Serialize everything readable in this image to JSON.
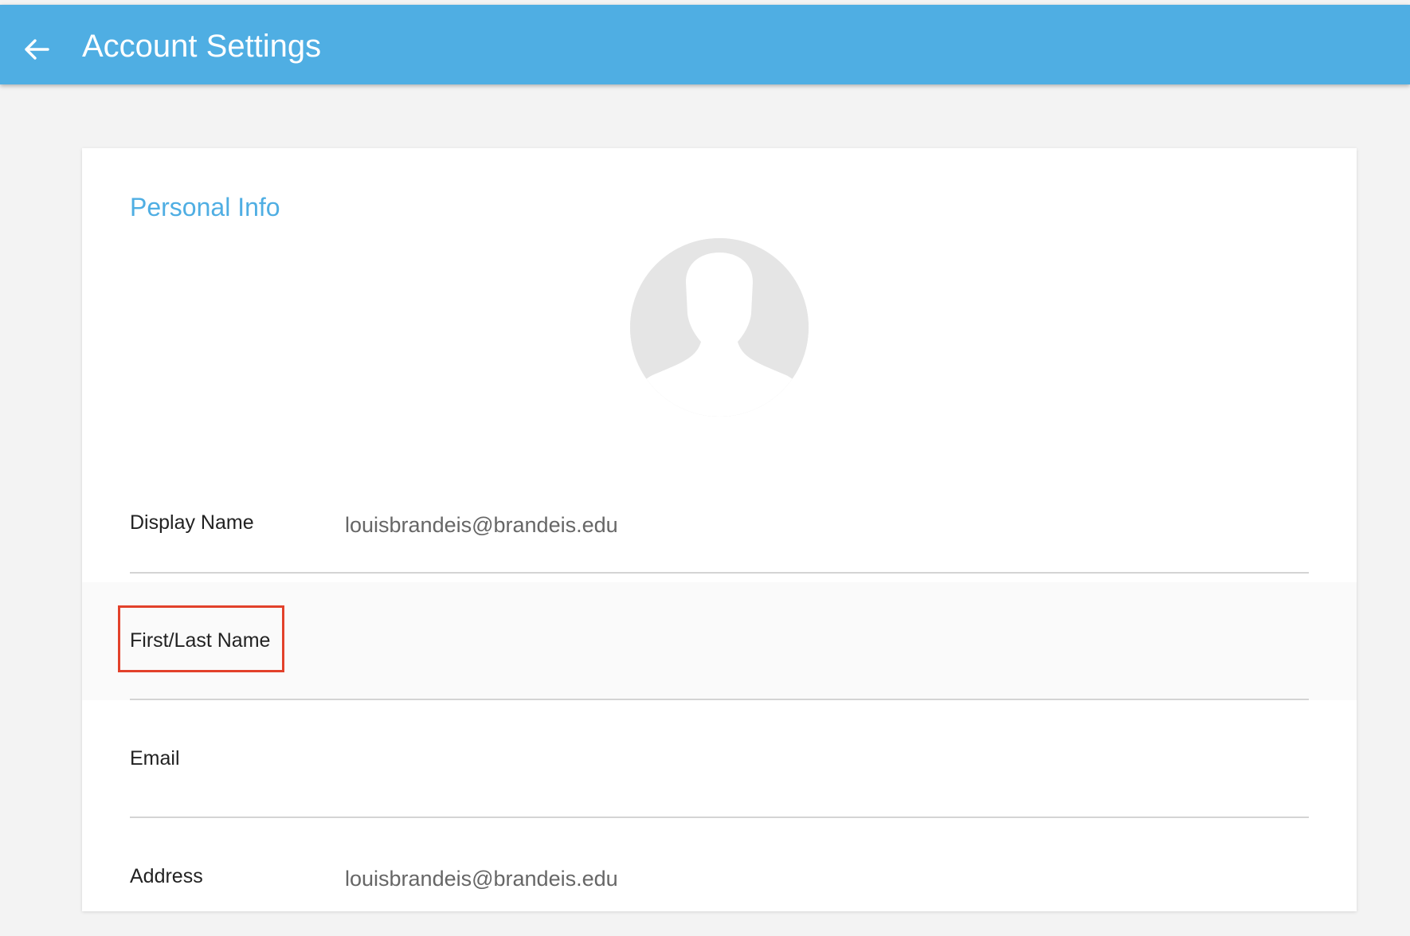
{
  "header": {
    "title": "Account Settings",
    "back_icon": "arrow-left-icon",
    "background_color": "#4faee3"
  },
  "card": {
    "section_title": "Personal Info",
    "avatar_icon": "user-silhouette-icon",
    "fields": [
      {
        "label": "Display Name",
        "value": "louisbrandeis@brandeis.edu"
      },
      {
        "label": "First/Last Name",
        "value": ""
      },
      {
        "label": "Email",
        "value": ""
      },
      {
        "label": "Address",
        "value": "louisbrandeis@brandeis.edu"
      }
    ]
  },
  "colors": {
    "accent": "#4faee3",
    "highlight_outline": "#e2412b",
    "row_highlight": "#fafafa"
  }
}
